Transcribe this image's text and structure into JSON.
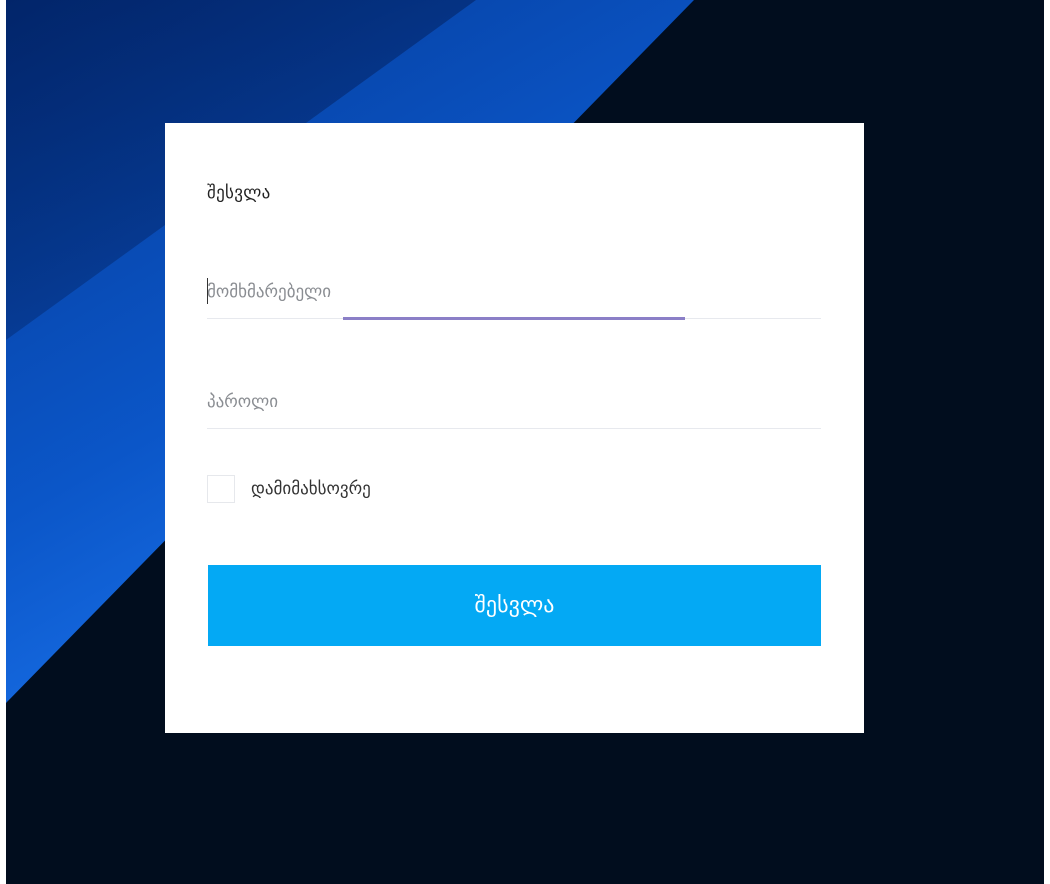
{
  "login": {
    "title": "შესვლა",
    "username": {
      "placeholder": "მომხმარებელი",
      "value": ""
    },
    "password": {
      "placeholder": "პაროლი",
      "value": ""
    },
    "remember_label": "დამიმახსოვრე",
    "remember_checked": false,
    "submit_label": "შესვლა"
  },
  "colors": {
    "background_dark": "#010d1e",
    "background_blue": "#2282ff",
    "submit_button": "#04a9f4",
    "focus_underline": "#8b7fc7",
    "card": "#ffffff"
  }
}
